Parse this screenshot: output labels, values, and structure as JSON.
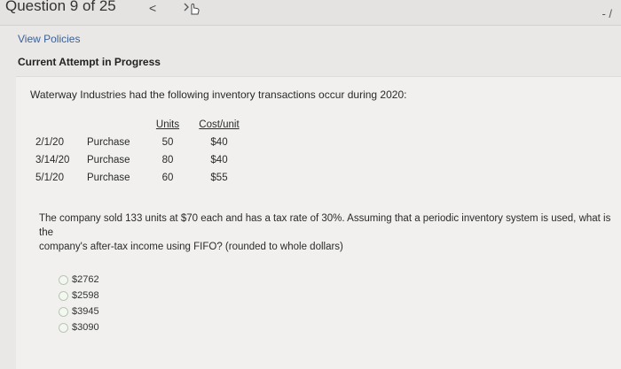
{
  "header": {
    "question_title": "Question 9 of 25",
    "prev_glyph": "<",
    "score": "- /"
  },
  "links": {
    "view_policies": "View Policies"
  },
  "attempt_status": "Current Attempt in Progress",
  "question": {
    "stem": "Waterway Industries had the following inventory transactions occur during 2020:",
    "table": {
      "headers": [
        "",
        "",
        "Units",
        "Cost/unit"
      ],
      "rows": [
        {
          "date": "2/1/20",
          "type": "Purchase",
          "units": "50",
          "cost": "$40"
        },
        {
          "date": "3/14/20",
          "type": "Purchase",
          "units": "80",
          "cost": "$40"
        },
        {
          "date": "5/1/20",
          "type": "Purchase",
          "units": "60",
          "cost": "$55"
        }
      ]
    },
    "prompt_line1": "The company sold 133 units at $70 each and has a tax rate of 30%. Assuming that a periodic inventory system is used, what is the",
    "prompt_line2": "company's after-tax income using FIFO? (rounded to whole dollars)",
    "options": [
      "$2762",
      "$2598",
      "$3945",
      "$3090"
    ]
  }
}
